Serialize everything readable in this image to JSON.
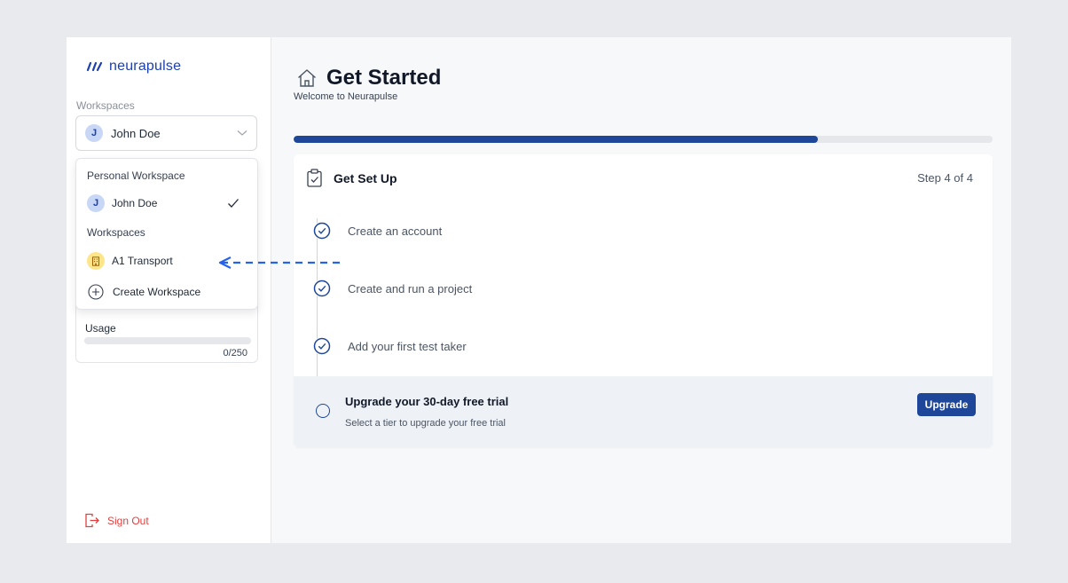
{
  "app": {
    "logo_text": "neurapulse"
  },
  "sidebar": {
    "workspaces_label": "Workspaces",
    "selected_workspace": {
      "initial": "J",
      "name": "John Doe"
    },
    "dropdown": {
      "personal_heading": "Personal Workspace",
      "personal_item": {
        "initial": "J",
        "name": "John Doe",
        "selected": true
      },
      "workspaces_heading": "Workspaces",
      "workspace_items": [
        {
          "name": "A1 Transport",
          "icon": "building-icon"
        }
      ],
      "create_label": "Create Workspace"
    },
    "usage": {
      "label": "Usage",
      "count": "0/250",
      "fraction": 0
    },
    "sign_out_label": "Sign Out"
  },
  "main": {
    "title": "Get Started",
    "subtitle": "Welcome to Neurapulse",
    "progress_fraction": 0.75,
    "setup": {
      "title": "Get Set Up",
      "step_counter": "Step 4 of 4",
      "steps": [
        {
          "label": "Create an account",
          "done": true
        },
        {
          "label": "Create and run a project",
          "done": true
        },
        {
          "label": "Add your first test taker",
          "done": true
        }
      ],
      "upgrade": {
        "title": "Upgrade your 30-day free trial",
        "description": "Select a tier to upgrade your free trial",
        "button_label": "Upgrade"
      }
    }
  },
  "colors": {
    "brand": "#1e4799",
    "accent_logo": "#1e40af",
    "danger": "#e53e3e",
    "annotation": "#2563eb"
  }
}
